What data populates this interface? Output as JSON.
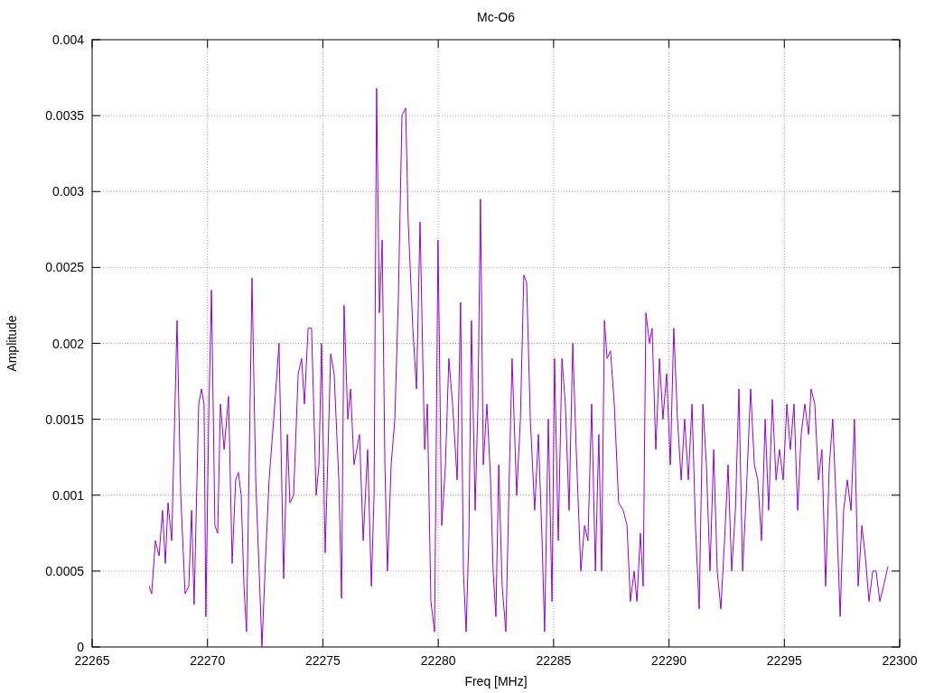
{
  "chart_data": {
    "type": "line",
    "title": "Mc-O6",
    "xlabel": "Freq [MHz]",
    "ylabel": "Amplitude",
    "grid": true,
    "xlim": [
      22265,
      22300
    ],
    "ylim": [
      0,
      0.004
    ],
    "xticks": [
      22265,
      22270,
      22275,
      22280,
      22285,
      22290,
      22295,
      22300
    ],
    "yticks": [
      0,
      0.0005,
      0.001,
      0.0015,
      0.002,
      0.0025,
      0.003,
      0.0035,
      0.004
    ],
    "x": [
      22267.47,
      22267.58,
      22267.74,
      22267.9,
      22268.05,
      22268.17,
      22268.29,
      22268.45,
      22268.68,
      22268.84,
      22269.03,
      22269.19,
      22269.31,
      22269.42,
      22269.62,
      22269.74,
      22269.85,
      22269.93,
      22270.05,
      22270.17,
      22270.32,
      22270.44,
      22270.56,
      22270.72,
      22270.91,
      22271.07,
      22271.22,
      22271.34,
      22271.46,
      22271.58,
      22271.69,
      22271.93,
      22272.09,
      22272.24,
      22272.36,
      22272.52,
      22272.67,
      22272.87,
      22273.1,
      22273.3,
      22273.46,
      22273.57,
      22273.73,
      22273.93,
      22274.08,
      22274.2,
      22274.36,
      22274.51,
      22274.71,
      22274.83,
      22274.94,
      22275.1,
      22275.34,
      22275.49,
      22275.69,
      22275.81,
      22275.92,
      22276.08,
      22276.2,
      22276.35,
      22276.59,
      22276.75,
      22276.94,
      22277.1,
      22277.22,
      22277.33,
      22277.45,
      22277.57,
      22277.69,
      22277.8,
      22277.96,
      22278.12,
      22278.27,
      22278.43,
      22278.59,
      22278.7,
      22278.9,
      22279.06,
      22279.21,
      22279.41,
      22279.53,
      22279.68,
      22279.84,
      22279.99,
      22280.15,
      22280.31,
      22280.46,
      22280.62,
      22280.82,
      22280.97,
      22281.09,
      22281.21,
      22281.33,
      22281.44,
      22281.6,
      22281.72,
      22281.83,
      22281.95,
      22282.11,
      22282.27,
      22282.38,
      22282.5,
      22282.62,
      22282.77,
      22282.93,
      22283.09,
      22283.2,
      22283.4,
      22283.56,
      22283.71,
      22283.83,
      22283.99,
      22284.18,
      22284.34,
      22284.5,
      22284.61,
      22284.77,
      22284.93,
      22285.04,
      22285.2,
      22285.36,
      22285.51,
      22285.67,
      22285.83,
      22285.98,
      22286.18,
      22286.34,
      22286.49,
      22286.65,
      22286.81,
      22286.96,
      22287.08,
      22287.2,
      22287.32,
      22287.47,
      22287.63,
      22287.82,
      22288.02,
      22288.18,
      22288.33,
      22288.49,
      22288.61,
      22288.76,
      22288.88,
      22289.0,
      22289.16,
      22289.27,
      22289.43,
      22289.59,
      22289.74,
      22289.9,
      22290.06,
      22290.21,
      22290.37,
      22290.53,
      22290.68,
      22290.84,
      22291.0,
      22291.15,
      22291.31,
      22291.47,
      22291.62,
      22291.78,
      22291.94,
      22292.09,
      22292.25,
      22292.41,
      22292.56,
      22292.72,
      22292.88,
      22293.03,
      22293.19,
      22293.35,
      22293.54,
      22293.7,
      22293.85,
      22294.01,
      22294.17,
      22294.32,
      22294.48,
      22294.64,
      22294.79,
      22294.95,
      22295.11,
      22295.26,
      22295.42,
      22295.58,
      22295.73,
      22295.89,
      22296.05,
      22296.16,
      22296.32,
      22296.48,
      22296.63,
      22296.79,
      22296.95,
      22297.1,
      22297.26,
      22297.42,
      22297.57,
      22297.73,
      22297.89,
      22298.04,
      22298.2,
      22298.36,
      22298.51,
      22298.67,
      22298.83,
      22298.98,
      22299.14,
      22299.3,
      22299.49
    ],
    "series": [
      {
        "color": "#9400d3",
        "values": [
          0.0004,
          0.00035,
          0.0007,
          0.0006,
          0.0009,
          0.00055,
          0.00095,
          0.0007,
          0.00215,
          0.001,
          0.00035,
          0.0004,
          0.0009,
          0.00028,
          0.0016,
          0.0017,
          0.0016,
          0.0002,
          0.0015,
          0.00235,
          0.0008,
          0.00075,
          0.0016,
          0.0013,
          0.00165,
          0.00055,
          0.0011,
          0.00115,
          0.001,
          0.0004,
          0.0001,
          0.00243,
          0.0011,
          0.0005,
          0.0,
          0.0006,
          0.0011,
          0.0015,
          0.002,
          0.00045,
          0.0014,
          0.00095,
          0.001,
          0.0018,
          0.0019,
          0.0016,
          0.0021,
          0.0021,
          0.001,
          0.0012,
          0.002,
          0.00062,
          0.00193,
          0.0018,
          0.0011,
          0.00032,
          0.00225,
          0.0015,
          0.0017,
          0.0012,
          0.0014,
          0.0007,
          0.0013,
          0.0004,
          0.001,
          0.00368,
          0.0022,
          0.00268,
          0.0012,
          0.0005,
          0.0012,
          0.0015,
          0.0023,
          0.0035,
          0.00355,
          0.0028,
          0.0021,
          0.0017,
          0.0028,
          0.0013,
          0.0016,
          0.0003,
          0.0001,
          0.00268,
          0.0008,
          0.0012,
          0.0019,
          0.0016,
          0.0011,
          0.00227,
          0.0005,
          0.0001,
          0.00073,
          0.00215,
          0.0009,
          0.0016,
          0.00295,
          0.0012,
          0.0016,
          0.0011,
          0.0005,
          0.0002,
          0.0012,
          0.0004,
          0.0001,
          0.0012,
          0.0019,
          0.001,
          0.0015,
          0.00245,
          0.0024,
          0.0015,
          0.0009,
          0.0014,
          0.0007,
          0.0001,
          0.0015,
          0.0003,
          0.0019,
          0.0007,
          0.0019,
          0.0016,
          0.0009,
          0.002,
          0.0013,
          0.0005,
          0.0008,
          0.0007,
          0.0016,
          0.0005,
          0.0014,
          0.0005,
          0.00215,
          0.0019,
          0.00195,
          0.0016,
          0.00095,
          0.0009,
          0.0008,
          0.0003,
          0.0005,
          0.0003,
          0.00075,
          0.0004,
          0.0022,
          0.002,
          0.0021,
          0.0013,
          0.0019,
          0.0015,
          0.0018,
          0.0012,
          0.0021,
          0.0015,
          0.0011,
          0.0015,
          0.0011,
          0.0016,
          0.0008,
          0.00025,
          0.0016,
          0.0012,
          0.0005,
          0.0013,
          0.0005,
          0.00025,
          0.0007,
          0.0012,
          0.0005,
          0.0009,
          0.0017,
          0.0005,
          0.001,
          0.0017,
          0.0012,
          0.0011,
          0.0007,
          0.0015,
          0.0009,
          0.00163,
          0.0011,
          0.0013,
          0.0011,
          0.0016,
          0.0013,
          0.0016,
          0.0009,
          0.0014,
          0.0016,
          0.0014,
          0.0017,
          0.0016,
          0.0011,
          0.0013,
          0.0004,
          0.0012,
          0.0015,
          0.0009,
          0.0002,
          0.0009,
          0.0011,
          0.0009,
          0.0015,
          0.0004,
          0.0008,
          0.0006,
          0.0003,
          0.0005,
          0.0005,
          0.0003,
          0.0004,
          0.00053
        ]
      }
    ]
  }
}
